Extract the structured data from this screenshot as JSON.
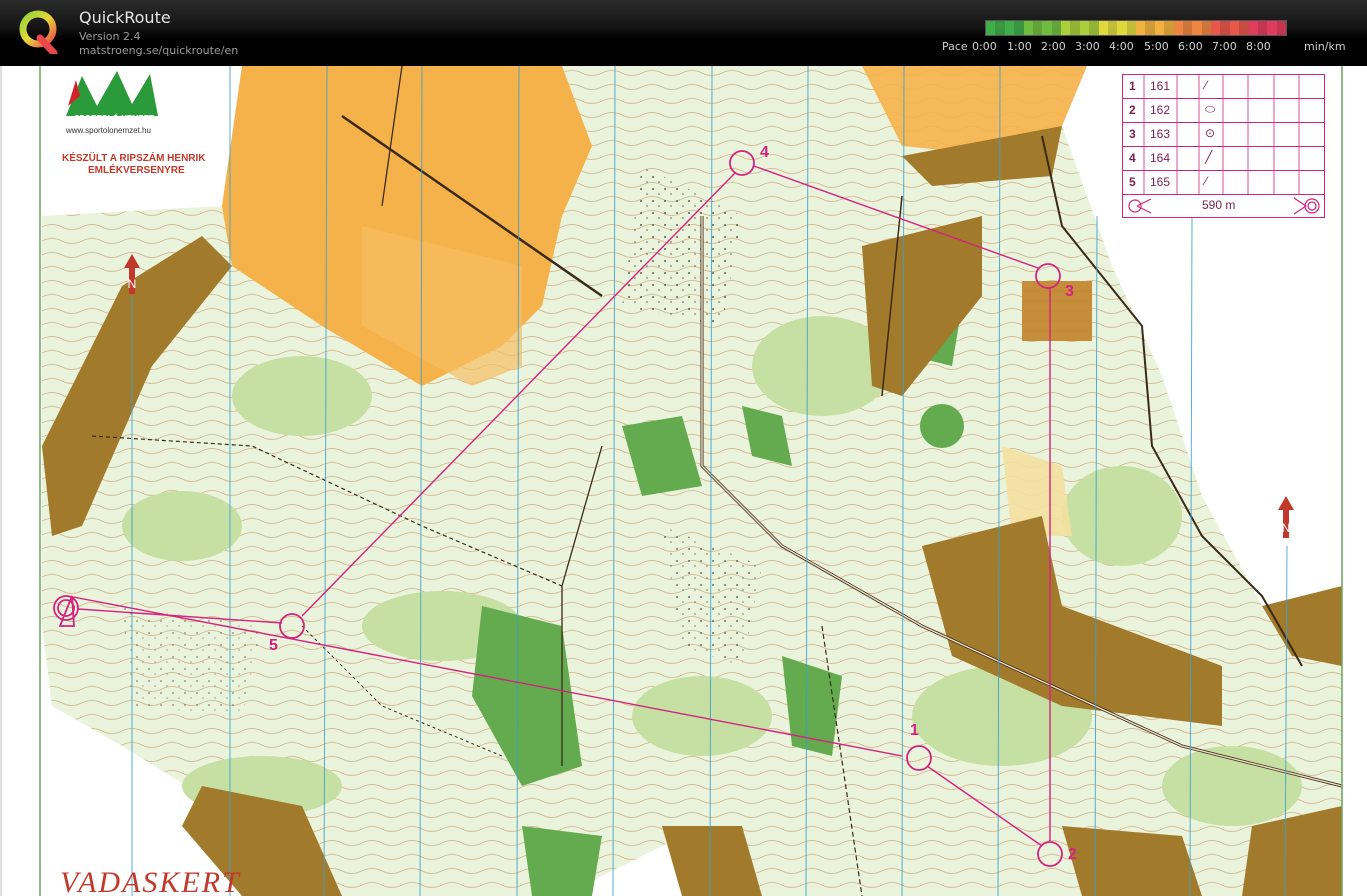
{
  "app": {
    "title": "QuickRoute",
    "version": "Version 2.4",
    "url": "matstroeng.se/quickroute/en"
  },
  "pace": {
    "label": "Pace",
    "ticks": [
      "0:00",
      "1:00",
      "2:00",
      "3:00",
      "4:00",
      "5:00",
      "6:00",
      "7:00",
      "8:00"
    ],
    "unit": "min/km",
    "colors": [
      "#3fae49",
      "#6fbd3f",
      "#a9cf3a",
      "#e0d93c",
      "#f2b33e",
      "#ef8640",
      "#e9564a",
      "#e03c5d"
    ]
  },
  "map": {
    "sponsor_logo_text": "SPORTOLÓ NEMZET",
    "sponsor_url": "www.sportolonemzet.hu",
    "event_line1": "KÉSZÜLT A RIPSZÁM HENRIK",
    "event_line2": "EMLÉKVERSENYRE",
    "place_name": "VADASKERT",
    "colors": {
      "course": "#d4237f",
      "open": "#f6b24a",
      "forest_green": "#5aa24a",
      "light_green": "#c9e2a8",
      "contour": "#b5651d",
      "building": "#a27a2c",
      "magnetic_lines": "#3aa0d0"
    }
  },
  "control_descriptions": {
    "rows": [
      {
        "num": "1",
        "code": "161",
        "symbol": "⁄"
      },
      {
        "num": "2",
        "code": "162",
        "symbol": "⬭"
      },
      {
        "num": "3",
        "code": "163",
        "symbol": "⊙"
      },
      {
        "num": "4",
        "code": "164",
        "symbol": "╱"
      },
      {
        "num": "5",
        "code": "165",
        "symbol": "⁄"
      }
    ],
    "length": "590 m"
  },
  "controls": [
    {
      "label": "1"
    },
    {
      "label": "2"
    },
    {
      "label": "3"
    },
    {
      "label": "4"
    },
    {
      "label": "5"
    }
  ]
}
